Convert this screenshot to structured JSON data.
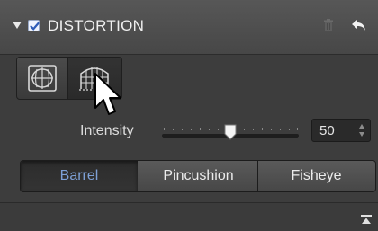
{
  "panel": {
    "title": "DISTORTION",
    "enabled": true,
    "collapsed": false
  },
  "icons": {
    "collapse": "triangle-down-icon",
    "enable": "checkbox-checked-icon",
    "trash": "trash-icon",
    "undo": "undo-arrow-icon",
    "mode_1": "spherize-grid-icon",
    "mode_2": "perspective-grid-icon",
    "cursor": "mouse-pointer-icon",
    "collapse_all": "collapse-all-icon"
  },
  "intensity": {
    "label": "Intensity",
    "value": "50",
    "level": 0.5
  },
  "segment": {
    "selected": "Barrel",
    "options": [
      "Barrel",
      "Pincushion",
      "Fisheye"
    ]
  },
  "colors": {
    "accent": "#7da0d6",
    "panel_bg": "#3d3d3d",
    "header_bg": "#4e4e4e"
  }
}
